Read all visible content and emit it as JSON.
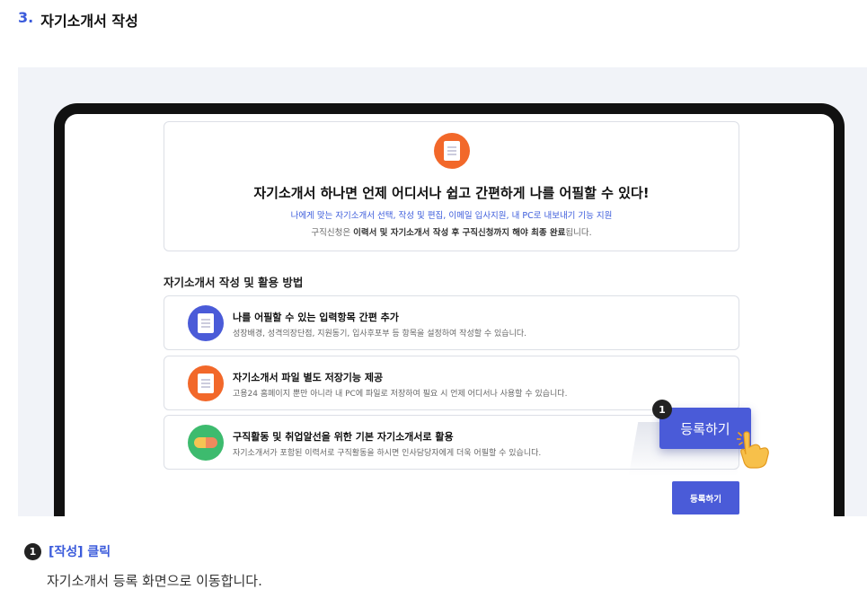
{
  "section": {
    "number": "3.",
    "title": "자기소개서 작성"
  },
  "hero": {
    "title": "자기소개서 하나면 언제 어디서나 쉽고 간편하게 나를 어필할 수 있다!",
    "subtitle": "나에게 맞는 자기소개서 선택, 작성 및 편집, 이메일 입사지원, 내 PC로 내보내기 기능 지원",
    "note_prefix": "구직신청은 ",
    "note_bold": "이력서 및 자기소개서 작성 후 구직신청까지 해야 최종 완료",
    "note_suffix": "됩니다."
  },
  "howto": {
    "title": "자기소개서 작성 및 활용 방법",
    "items": [
      {
        "title": "나를 어필할 수 있는 입력항목 간편 추가",
        "desc": "성장배경, 성격의장단점, 지원동기, 입사후포부 등 항목을 설정하여 작성할 수 있습니다.",
        "icon": "document-edit-icon",
        "color": "#4a5bd8"
      },
      {
        "title": "자기소개서 파일 별도 저장기능 제공",
        "desc": "고용24 홈페이지 뿐만 아니라 내 PC에 파일로 저장하여 필요 시 언제 어디서나 사용할 수 있습니다.",
        "icon": "document-icon",
        "color": "#f2682a"
      },
      {
        "title": "구직활동 및 취업알선을 위한 기본 자기소개서로 활용",
        "desc": "자기소개서가 포함된 이력서로 구직활동을 하시면 인사담당자에게 더욱 어필할 수 있습니다.",
        "icon": "handshake-icon",
        "color": "#3dbb6e"
      }
    ]
  },
  "buttons": {
    "register_small": "등록하기",
    "register_callout": "등록하기"
  },
  "callout_marker": "1",
  "step": {
    "marker": "1",
    "title": "[작성] 클릭",
    "desc": "자기소개서 등록 화면으로 이동합니다."
  },
  "colors": {
    "accent": "#3b5bdb",
    "button": "#4a5bd8",
    "orange": "#f2682a",
    "green": "#3dbb6e"
  }
}
